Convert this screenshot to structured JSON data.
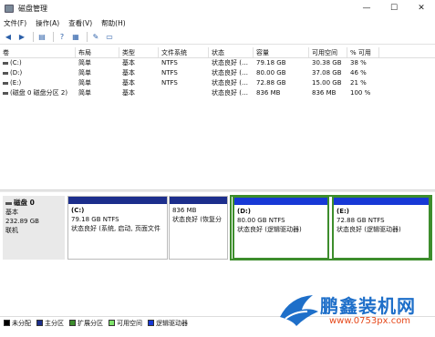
{
  "window": {
    "title": "磁盘管理",
    "controls": [
      "—",
      "☐",
      "✕"
    ]
  },
  "menu": [
    "文件(F)",
    "操作(A)",
    "查看(V)",
    "帮助(H)"
  ],
  "toolbar": {
    "icons": [
      "back-icon",
      "forward-icon",
      "properties-icon",
      "help-icon",
      "volume-icon",
      "rescan-icon",
      "connect-icon",
      "settings-icon"
    ]
  },
  "volume_table": {
    "columns": [
      "卷",
      "布局",
      "类型",
      "文件系统",
      "状态",
      "容量",
      "可用空间",
      "% 可用"
    ],
    "rows": [
      [
        "(C:)",
        "简单",
        "基本",
        "NTFS",
        "状态良好 (…",
        "79.18 GB",
        "30.38 GB",
        "38 %"
      ],
      [
        "(D:)",
        "简单",
        "基本",
        "NTFS",
        "状态良好 (…",
        "80.00 GB",
        "37.08 GB",
        "46 %"
      ],
      [
        "(E:)",
        "简单",
        "基本",
        "NTFS",
        "状态良好 (…",
        "72.88 GB",
        "15.00 GB",
        "21 %"
      ],
      [
        "(磁盘 0 磁盘分区 2)",
        "简单",
        "基本",
        "",
        "状态良好 (…",
        "836 MB",
        "836 MB",
        "100 %"
      ]
    ]
  },
  "disk": {
    "name": "磁盘 0",
    "type": "基本",
    "size": "232.89 GB",
    "status": "联机"
  },
  "partitions": [
    {
      "name": "(C:)",
      "size": "79.18 GB NTFS",
      "status": "状态良好 (系统, 启动, 页面文件"
    },
    {
      "name": "",
      "size": "836 MB",
      "status": "状态良好 (恢复分"
    },
    {
      "name": "(D:)",
      "size": "80.00 GB NTFS",
      "status": "状态良好 (逻辑驱动器)"
    },
    {
      "name": "(E:)",
      "size": "72.88 GB NTFS",
      "status": "状态良好 (逻辑驱动器)"
    }
  ],
  "legend": [
    {
      "label": "未分配",
      "color": "#000000"
    },
    {
      "label": "主分区",
      "color": "#1c2e8c"
    },
    {
      "label": "扩展分区",
      "color": "#3d8d2c"
    },
    {
      "label": "可用空间",
      "color": "#7fe36b"
    },
    {
      "label": "逻辑驱动器",
      "color": "#1739d6"
    }
  ],
  "watermark": {
    "brand": "鹏鑫装机网",
    "url": "www.0753px.com"
  }
}
